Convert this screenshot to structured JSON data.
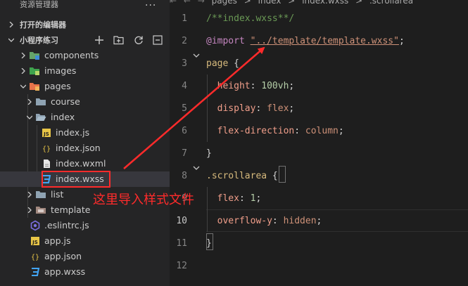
{
  "explorer": {
    "title": "资源管理器",
    "more": "...",
    "open_editors": "打开的编辑器",
    "project": "小程序练习",
    "items": [
      {
        "label": "components",
        "icon": "components-folder-icon",
        "twisty": "right"
      },
      {
        "label": "images",
        "icon": "images-folder-icon",
        "twisty": "right"
      },
      {
        "label": "pages",
        "icon": "pages-folder-icon",
        "twisty": "down"
      },
      {
        "label": "course",
        "icon": "folder-icon",
        "twisty": "right"
      },
      {
        "label": "index",
        "icon": "folder-open-icon",
        "twisty": "down"
      },
      {
        "label": "index.js",
        "icon": "js-file-icon"
      },
      {
        "label": "index.json",
        "icon": "json-file-icon"
      },
      {
        "label": "index.wxml",
        "icon": "wxml-file-icon"
      },
      {
        "label": "index.wxss",
        "icon": "wxss-file-icon",
        "selected": true
      },
      {
        "label": "list",
        "icon": "folder-icon",
        "twisty": "right"
      },
      {
        "label": "template",
        "icon": "template-folder-icon",
        "twisty": "right"
      },
      {
        "label": ".eslintrc.js",
        "icon": "eslint-file-icon"
      },
      {
        "label": "app.js",
        "icon": "js-file-icon"
      },
      {
        "label": "app.json",
        "icon": "json-file-icon"
      },
      {
        "label": "app.wxss",
        "icon": "wxss-file-icon"
      }
    ]
  },
  "editor": {
    "breadcrumb": [
      "pages",
      ">",
      "index",
      ">",
      "index.wxss",
      ">",
      ".scrollarea"
    ],
    "active_line": "10",
    "lines": [
      {
        "n": "1",
        "parts": [
          {
            "t": "/**index.wxss**/",
            "c": "c-comment"
          }
        ]
      },
      {
        "n": "2",
        "parts": [
          {
            "t": "@import ",
            "c": "c-import"
          },
          {
            "t": "\"../template/template.wxss\"",
            "c": "c-str"
          },
          {
            "t": ";",
            "c": "c-punc"
          }
        ]
      },
      {
        "n": "3",
        "parts": [
          {
            "t": "page ",
            "c": "c-sel"
          },
          {
            "t": "{",
            "c": "c-brace"
          }
        ]
      },
      {
        "n": "4",
        "parts": [
          {
            "t": "  height",
            "c": "c-prop2"
          },
          {
            "t": ": ",
            "c": "c-punc"
          },
          {
            "t": "100vh",
            "c": "c-num"
          },
          {
            "t": ";",
            "c": "c-punc"
          }
        ]
      },
      {
        "n": "5",
        "parts": [
          {
            "t": "  display",
            "c": "c-prop2"
          },
          {
            "t": ": ",
            "c": "c-punc"
          },
          {
            "t": "flex",
            "c": "c-val"
          },
          {
            "t": ";",
            "c": "c-punc"
          }
        ]
      },
      {
        "n": "6",
        "parts": [
          {
            "t": "  flex-direction",
            "c": "c-prop2"
          },
          {
            "t": ": ",
            "c": "c-punc"
          },
          {
            "t": "column",
            "c": "c-val"
          },
          {
            "t": ";",
            "c": "c-punc"
          }
        ]
      },
      {
        "n": "7",
        "parts": [
          {
            "t": "}",
            "c": "c-brace"
          }
        ]
      },
      {
        "n": "8",
        "parts": [
          {
            "t": ".scrollarea ",
            "c": "c-sel"
          },
          {
            "t": "{",
            "c": "c-brace"
          }
        ]
      },
      {
        "n": "9",
        "parts": [
          {
            "t": "  flex",
            "c": "c-prop2"
          },
          {
            "t": ": ",
            "c": "c-punc"
          },
          {
            "t": "1",
            "c": "c-num"
          },
          {
            "t": ";",
            "c": "c-punc"
          }
        ]
      },
      {
        "n": "10",
        "parts": [
          {
            "t": "  overflow-y",
            "c": "c-prop2"
          },
          {
            "t": ": ",
            "c": "c-punc"
          },
          {
            "t": "hidden",
            "c": "c-val"
          },
          {
            "t": ";",
            "c": "c-punc"
          }
        ]
      },
      {
        "n": "11",
        "parts": [
          {
            "t": "}",
            "c": "c-brace"
          }
        ]
      },
      {
        "n": "12",
        "parts": []
      }
    ]
  },
  "annotation": {
    "text": "这里导入样式文件",
    "color": "#ff2b2b"
  }
}
